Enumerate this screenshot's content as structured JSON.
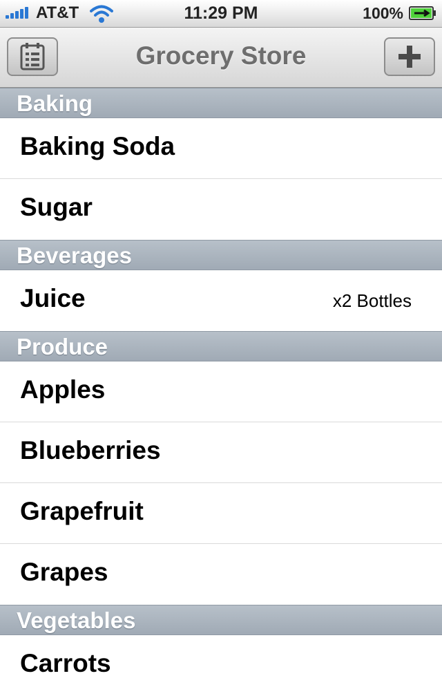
{
  "status_bar": {
    "carrier": "AT&T",
    "time": "11:29 PM",
    "battery_percent": "100%"
  },
  "nav": {
    "title": "Grocery Store",
    "left_icon": "list-icon",
    "right_icon": "plus-icon"
  },
  "sections": [
    {
      "header": "Baking",
      "items": [
        {
          "name": "Baking Soda",
          "detail": ""
        },
        {
          "name": "Sugar",
          "detail": ""
        }
      ]
    },
    {
      "header": "Beverages",
      "items": [
        {
          "name": "Juice",
          "detail": "x2 Bottles"
        }
      ]
    },
    {
      "header": "Produce",
      "items": [
        {
          "name": "Apples",
          "detail": ""
        },
        {
          "name": "Blueberries",
          "detail": ""
        },
        {
          "name": "Grapefruit",
          "detail": ""
        },
        {
          "name": "Grapes",
          "detail": ""
        }
      ]
    },
    {
      "header": "Vegetables",
      "items": [
        {
          "name": "Carrots",
          "detail": ""
        }
      ]
    }
  ]
}
